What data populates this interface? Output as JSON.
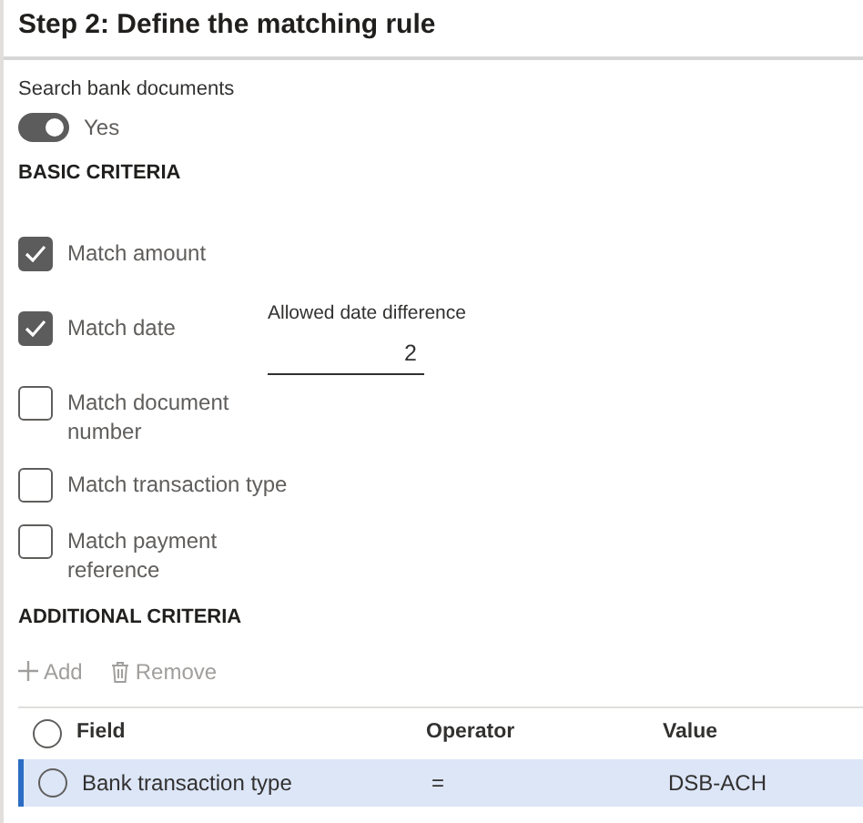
{
  "header": {
    "title": "Step 2: Define the matching rule"
  },
  "search_bank_documents": {
    "label": "Search bank documents",
    "on": true,
    "value": "Yes"
  },
  "basic_criteria": {
    "heading": "BASIC CRITERIA",
    "items": [
      {
        "label": "Match amount",
        "checked": true
      },
      {
        "label": "Match date",
        "checked": true,
        "extra_field": {
          "label": "Allowed date difference",
          "value": "2"
        }
      },
      {
        "label": "Match document number",
        "checked": false
      },
      {
        "label": "Match transaction type",
        "checked": false
      },
      {
        "label": "Match payment reference",
        "checked": false
      }
    ]
  },
  "additional_criteria": {
    "heading": "ADDITIONAL CRITERIA",
    "toolbar": [
      {
        "kind": "add",
        "label": "Add",
        "disabled": true
      },
      {
        "kind": "remove",
        "label": "Remove",
        "disabled": true
      }
    ],
    "table": {
      "select_all": {
        "selected": false
      },
      "columns": [
        "Field",
        "Operator",
        "Value"
      ],
      "rows": [
        {
          "cells": [
            "Bank transaction type",
            "=",
            "DSB-ACH"
          ],
          "selected": true
        }
      ]
    }
  }
}
